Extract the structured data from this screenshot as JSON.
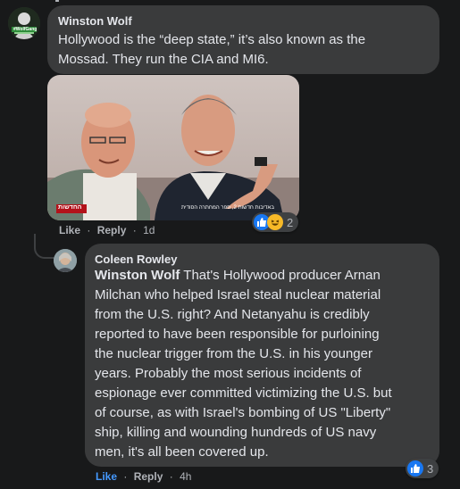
{
  "comment1": {
    "author": "Winston Wolf",
    "avatar_label": "#WolfGang",
    "text_line1": "Hollywood is the “deep state,” it’s also known as the",
    "text_line2": "Mossad. They run the CIA and MI6.",
    "image_watermark_left": "החדשות",
    "image_watermark_right": "באדיבות חדשות 2, ספר המחתרה הסודית",
    "reactions_count": "2",
    "reaction_icons": [
      "like-icon",
      "haha-icon"
    ],
    "like_label": "Like",
    "reply_label": "Reply",
    "separator": "·",
    "time": "1d"
  },
  "comment2": {
    "author": "Coleen Rowley",
    "mention": "Winston Wolf",
    "text_lines": [
      " That's Hollywood producer Arnan",
      "Milchan who helped Israel steal nuclear material",
      "from the U.S. right? And Netanyahu is credibly",
      "reported to have been responsible for purloining",
      "the nuclear trigger from the U.S. in his younger",
      "years. Probably the most serious incidents of",
      "espionage ever committed victimizing the U.S. but",
      "of course, as with Israel's bombing of US \"Liberty\"",
      "ship, killing and wounding hundreds of US navy",
      "men, it's all been covered up."
    ],
    "reactions_count": "3",
    "reaction_icons": [
      "like-icon"
    ],
    "like_label": "Like",
    "reply_label": "Reply",
    "separator": "·",
    "time": "4h"
  },
  "colors": {
    "background": "#18191a",
    "bubble": "#3a3b3c",
    "text": "#e4e6eb",
    "secondary_text": "#b0b3b8",
    "like_blue": "#1877f2",
    "link_blue": "#4599ff"
  }
}
